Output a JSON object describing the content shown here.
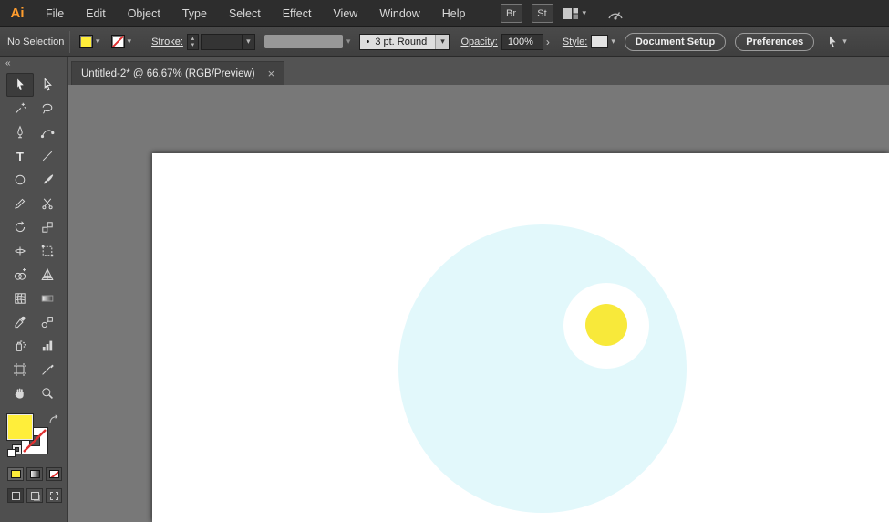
{
  "app": {
    "name": "Adobe Illustrator"
  },
  "menubar": {
    "logo_text": "Ai",
    "items": [
      "File",
      "Edit",
      "Object",
      "Type",
      "Select",
      "Effect",
      "View",
      "Window",
      "Help"
    ],
    "bridge_label": "Br",
    "stock_label": "St"
  },
  "controlbar": {
    "selection_status": "No Selection",
    "stroke_label": "Stroke:",
    "brush_bullet": "•",
    "brush_name": "3 pt. Round",
    "opacity_label": "Opacity:",
    "opacity_value": "100%",
    "style_label": "Style:",
    "document_setup_label": "Document Setup",
    "preferences_label": "Preferences"
  },
  "panel": {
    "collapse_glyph": "«"
  },
  "tab": {
    "title": "Untitled-2* @ 66.67% (RGB/Preview)",
    "close_glyph": "×"
  },
  "toolbar": {
    "type_glyph": "T",
    "tools": [
      "selection",
      "direct-selection",
      "magic-wand",
      "lasso",
      "pen",
      "curvature",
      "type",
      "line-segment",
      "ellipse",
      "paintbrush",
      "pencil",
      "scissors",
      "rotate",
      "scale",
      "width",
      "free-transform",
      "shape-builder",
      "perspective-grid",
      "mesh",
      "gradient",
      "eyedropper",
      "blend",
      "symbol-sprayer",
      "column-graph",
      "artboard",
      "slice",
      "hand",
      "zoom"
    ],
    "selected_tool": "selection"
  },
  "swatches": {
    "fill_color": "#ffee3a",
    "stroke": "none",
    "stroke_none_red": "#e03131"
  },
  "canvas": {
    "pasteboard_color": "#787878",
    "artboard_color": "#ffffff",
    "shapes": [
      {
        "name": "sky-circle",
        "type": "ellipse",
        "fill": "#e2f8fb"
      },
      {
        "name": "white-circle",
        "type": "ellipse",
        "fill": "#ffffff"
      },
      {
        "name": "sun-circle",
        "type": "ellipse",
        "fill": "#f8e93a"
      }
    ]
  }
}
